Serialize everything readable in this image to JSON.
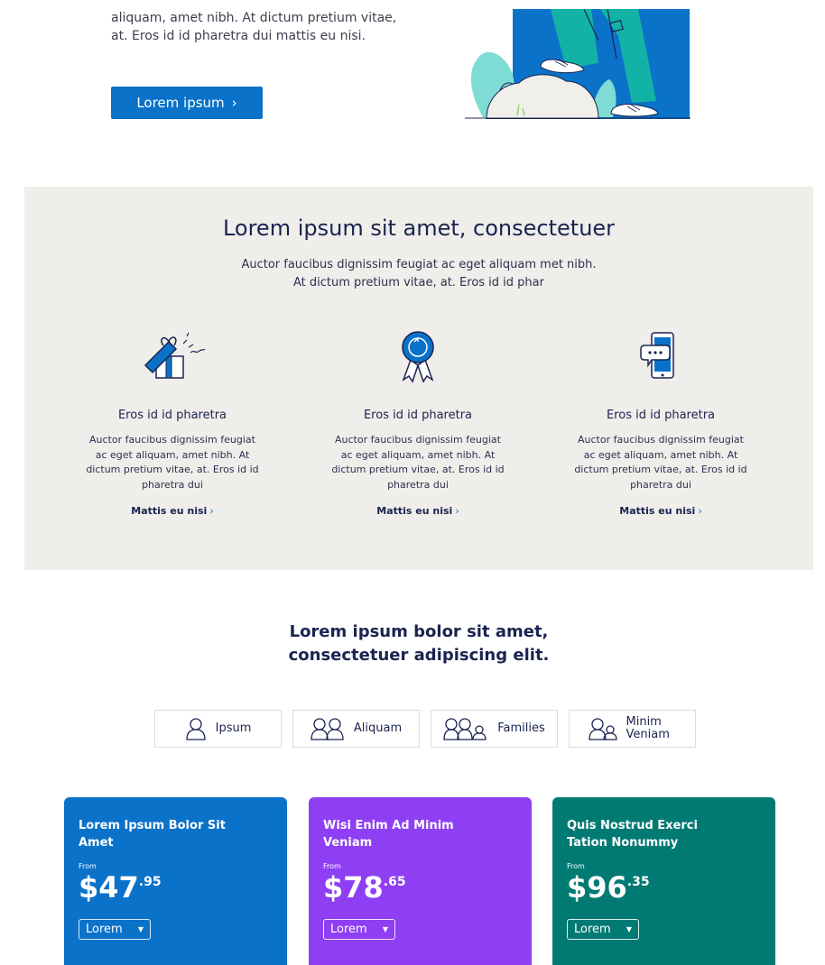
{
  "hero": {
    "text": "aliquam, amet nibh. At dictum pretium vitae, at. Eros id id pharetra dui mattis eu nisi.",
    "button_label": "Lorem ipsum",
    "button_chevron": "›"
  },
  "features": {
    "title": "Lorem ipsum sit amet, consectetuer",
    "subtitle": "Auctor faucibus dignissim feugiat ac eget aliquam met nibh. At dictum pretium vitae, at. Eros id id phar",
    "items": [
      {
        "icon": "gift-box-icon",
        "title": "Eros id id pharetra",
        "description": "Auctor faucibus dignissim feugiat ac eget aliquam, amet nibh. At dictum pretium vitae, at. Eros id id pharetra dui",
        "link": "Mattis eu nisi",
        "chevron": "›"
      },
      {
        "icon": "award-ribbon-icon",
        "title": "Eros id id pharetra",
        "description": "Auctor faucibus dignissim feugiat ac eget aliquam, amet nibh. At dictum pretium vitae, at. Eros id id pharetra dui",
        "link": "Mattis eu nisi",
        "chevron": "›"
      },
      {
        "icon": "phone-chat-icon",
        "title": "Eros id id pharetra",
        "description": "Auctor faucibus dignissim feugiat ac eget aliquam, amet nibh. At dictum pretium vitae, at. Eros id id pharetra dui",
        "link": "Mattis eu nisi",
        "chevron": "›"
      }
    ]
  },
  "plans": {
    "title_line1": "Lorem ipsum bolor sit amet,",
    "title_line2": "consectetuer adipiscing elit.",
    "tabs": [
      {
        "label": "Ipsum",
        "icon": "single-person-icon"
      },
      {
        "label": "Aliquam",
        "icon": "two-people-icon"
      },
      {
        "label": "Families",
        "icon": "family-icon"
      },
      {
        "label": "Minim Veniam",
        "icon": "adult-child-icon"
      }
    ],
    "cards": [
      {
        "title": "Lorem Ipsum Bolor Sit Amet",
        "from": "From",
        "price": "$47",
        "cents": ".95",
        "select": "Lorem",
        "color": "#0b72c9"
      },
      {
        "title": "Wisi Enim Ad Minim Veniam",
        "from": "From",
        "price": "$78",
        "cents": ".65",
        "select": "Lorem",
        "color": "#8e3ff3"
      },
      {
        "title": "Quis Nostrud Exerci Tation Nonummy",
        "from": "From",
        "price": "$96",
        "cents": ".35",
        "select": "Lorem",
        "color": "#017a73"
      }
    ]
  },
  "colors": {
    "primary_blue": "#0b72c9",
    "purple": "#8e3ff3",
    "teal": "#017a73",
    "feature_background": "#efeeea",
    "heading_navy": "#1b2350"
  }
}
